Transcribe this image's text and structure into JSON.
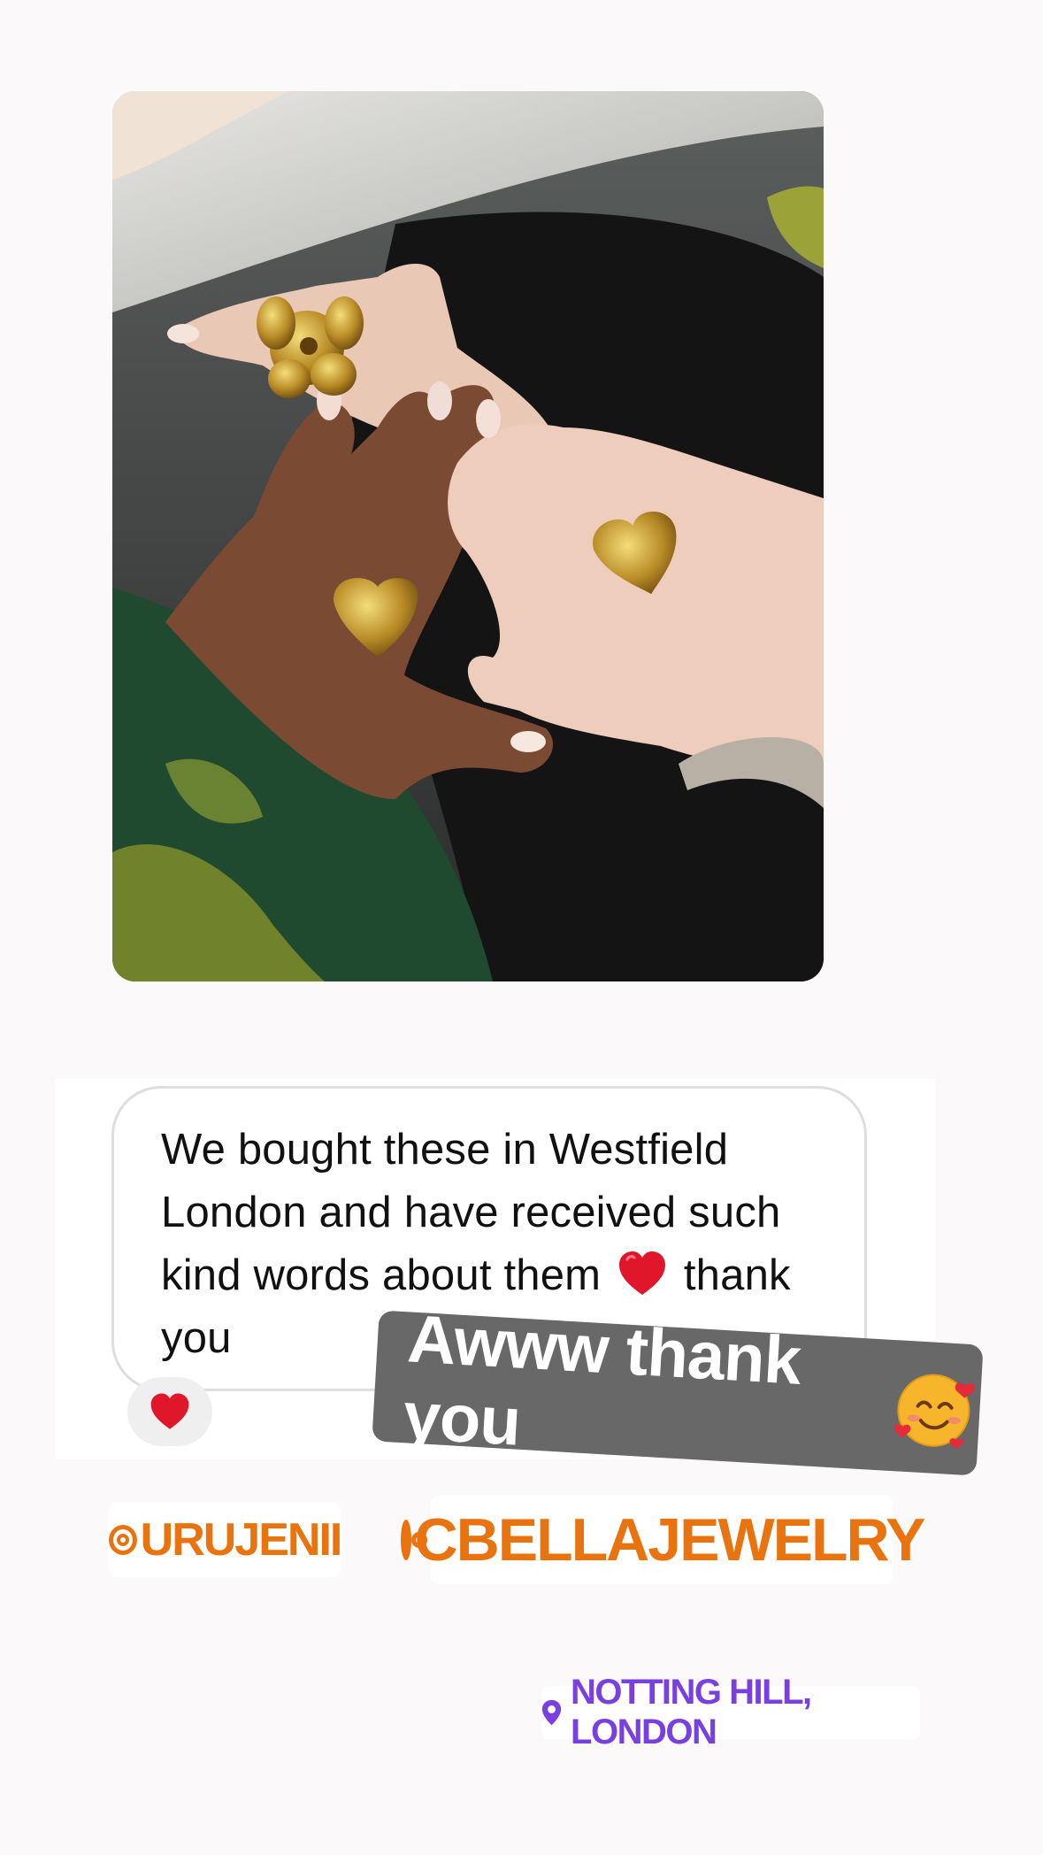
{
  "story": {
    "photo": {
      "icon": "photo-hands-rings"
    },
    "shared_message": {
      "text_before_emoji": "We bought these in Westfield London and have received such kind words about them",
      "emoji_icon": "red-heart-icon",
      "text_after_emoji": "thank you",
      "reaction_icon": "red-heart-icon"
    },
    "reply_sticker": {
      "text": "Awww thank you",
      "emoji_icon": "smiling-face-with-hearts-icon"
    },
    "mentions": [
      {
        "label": "URUJENII"
      },
      {
        "label": "CBELLAJEWELRY"
      }
    ],
    "location": {
      "label": "NOTTING HILL, LONDON",
      "icon": "location-pin-icon"
    }
  },
  "colors": {
    "background": "#fbf9fa",
    "mention": "#e8730f",
    "location": "#7a3fe0",
    "reply_sticker_bg": "#686868",
    "heart": "#e0162b"
  }
}
